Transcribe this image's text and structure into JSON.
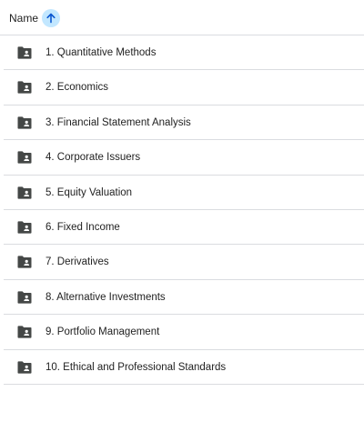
{
  "header": {
    "sort_label": "Name",
    "sort_direction_icon": "arrow-up-icon"
  },
  "files": {
    "item_icon": "shared-folder-icon",
    "items": [
      {
        "label": "1. Quantitative Methods"
      },
      {
        "label": "2. Economics"
      },
      {
        "label": "3. Financial Statement Analysis"
      },
      {
        "label": "4. Corporate Issuers"
      },
      {
        "label": "5. Equity Valuation"
      },
      {
        "label": "6. Fixed Income"
      },
      {
        "label": "7. Derivatives"
      },
      {
        "label": "8. Alternative Investments"
      },
      {
        "label": "9. Portfolio Management"
      },
      {
        "label": "10. Ethical and Professional Standards"
      }
    ]
  },
  "colors": {
    "folder": "#444746",
    "sort_badge": "#c2e7ff",
    "sort_arrow": "#0b57d0",
    "divider": "#dadce0"
  }
}
